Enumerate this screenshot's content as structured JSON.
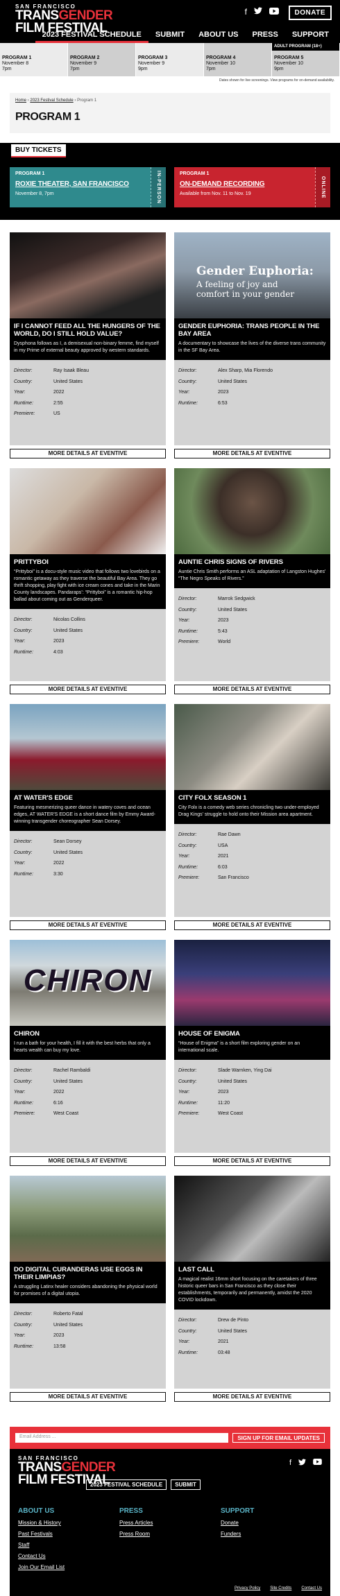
{
  "header": {
    "logo": {
      "small": "SAN FRANCISCO",
      "trans": "TRANS",
      "gender": "GENDER",
      "film": "FILM FESTIVAL"
    },
    "social_icons": [
      "facebook-icon",
      "twitter-icon",
      "youtube-icon"
    ],
    "donate_label": "DONATE",
    "nav": [
      "2023 FESTIVAL SCHEDULE",
      "SUBMIT",
      "ABOUT US",
      "PRESS",
      "SUPPORT"
    ]
  },
  "programs": [
    {
      "name": "PROGRAM 1",
      "date": "November 8",
      "time": "7pm"
    },
    {
      "name": "PROGRAM 2",
      "date": "November 9",
      "time": "7pm"
    },
    {
      "name": "PROGRAM 3",
      "date": "November 9",
      "time": "9pm"
    },
    {
      "name": "PROGRAM 4",
      "date": "November 10",
      "time": "7pm"
    },
    {
      "name": "PROGRAM 5",
      "date": "November 10",
      "time": "9pm",
      "badge": "ADULT PROGRAM (18+)"
    }
  ],
  "strip_note": "Dates shown for live screenings. View programs for on-demand availability.",
  "breadcrumb": {
    "home": "Home",
    "schedule": "2023 Festival Schedule",
    "current": "Program 1"
  },
  "page_title": "PROGRAM 1",
  "tickets": {
    "label": "BUY TICKETS",
    "items": [
      {
        "program": "PROGRAM 1",
        "venue": "ROXIE THEATER, SAN FRANCISCO",
        "date": "November 8, 7pm",
        "mode": "IN-PERSON"
      },
      {
        "program": "PROGRAM 1",
        "venue": "ON-DEMAND RECORDING",
        "date": "Available from Nov. 11 to Nov. 19",
        "mode": "ONLINE"
      }
    ]
  },
  "meta_labels": {
    "director": "Director:",
    "country": "Country:",
    "year": "Year:",
    "runtime": "Runtime:",
    "premiere": "Premiere:"
  },
  "eventive_label": "MORE DETAILS AT EVENTIVE",
  "films": [
    {
      "title": "IF I CANNOT FEED ALL THE HUNGERS OF THE WORLD, DO I STILL HOLD VALUE?",
      "desc": "Dysphona follows as I, a demisexual non-binary femme, find myself in my Prime of external beauty approved by western standards.",
      "director": "Ray Isaak Bleau",
      "country": "United States",
      "year": "2022",
      "runtime": "2:55",
      "premiere": "US"
    },
    {
      "title": "GENDER EUPHORIA: TRANS PEOPLE IN THE BAY AREA",
      "desc": "A documentary to showcase the lives of the diverse trans community in the SF Bay Area.",
      "director": "Alex Sharp, Mia Florendo",
      "country": "United States",
      "year": "2023",
      "runtime": "6:53",
      "premiere": "",
      "thumb_title": "Gender Euphoria:",
      "thumb_sub": "A feeling of joy and comfort in your gender"
    },
    {
      "title": "PRITTYBOI",
      "desc": "“Prittyboi” is a docu-style music video that follows two lovebirds on a romantic getaway as they traverse the beautiful Bay Area. They go thrift shopping, play fight with ice cream cones and take in the Marin County landscapes. Pandaraps’: “Prittyboi” is a romantic hip-hop ballad about coming out as Genderqueer.",
      "director": "Nicolas Collins",
      "country": "United States",
      "year": "2023",
      "runtime": "4:03",
      "premiere": ""
    },
    {
      "title": "AUNTIE CHRIS SIGNS OF RIVERS",
      "desc": "Auntie Chris Smith performs an ASL adaptation of Langston Hughes' “The Negro Speaks of Rivers.”",
      "director": "Marrok Sedgwick",
      "country": "United States",
      "year": "2023",
      "runtime": "5:43",
      "premiere": "World"
    },
    {
      "title": "AT WATER'S EDGE",
      "desc": "Featuring mesmerizing queer dance in watery coves and ocean edges, AT WATER'S EDGE is a short dance film by Emmy Award-winning transgender choreographer Sean Dorsey.",
      "director": "Sean Dorsey",
      "country": "United States",
      "year": "2022",
      "runtime": "3:30",
      "premiere": ""
    },
    {
      "title": "CITY FOLX SEASON 1",
      "desc": "City Folx is a comedy web series chronicling two under-employed Drag Kings' struggle to hold onto their Mission area apartment.",
      "director": "Rae Dawn",
      "country": "USA",
      "year": "2021",
      "runtime": "6:03",
      "premiere": "San Francisco"
    },
    {
      "title": "CHIRON",
      "desc": "I run a bath for your health, I fill it with the best herbs that only a hearts wealth can buy my love.",
      "director": "Rachel Rambaldi",
      "country": "United States",
      "year": "2022",
      "runtime": "6:16",
      "premiere": "West Coast",
      "thumb_title": "CHIRON"
    },
    {
      "title": "HOUSE OF ENIGMA",
      "desc": "“House of Enigma” is a short film exploring gender on an international scale.",
      "director": "Slade Warnken, Ying Dai",
      "country": "United States",
      "year": "2023",
      "runtime": "11:20",
      "premiere": "West Coast"
    },
    {
      "title": "DO DIGITAL CURANDERAS USE EGGS IN THEIR LIMPIAS?",
      "desc": "A struggling Latinx healer considers abandoning the physical world for promises of a digital utopia.",
      "director": "Roberto Fatal",
      "country": "United States",
      "year": "2023",
      "runtime": "13:58",
      "premiere": ""
    },
    {
      "title": "LAST CALL",
      "desc": "A magical realist 16mm short focusing on the caretakers of three historic queer bars in San Francisco as they close their establishments, temporarily and permanently, amidst the 2020 COVID lockdown.",
      "director": "Drew de Pinto",
      "country": "United States",
      "year": "2021",
      "runtime": "03:48",
      "premiere": ""
    }
  ],
  "signup": {
    "placeholder": "Email Address ...",
    "button": "SIGN UP FOR EMAIL UPDATES"
  },
  "footer": {
    "buttons": [
      "2023 FESTIVAL SCHEDULE",
      "SUBMIT"
    ],
    "columns": [
      {
        "heading": "ABOUT US",
        "links": [
          "Mission & History",
          "Past Festivals",
          "Staff",
          "Contact Us",
          "Join Our Email List"
        ]
      },
      {
        "heading": "PRESS",
        "links": [
          "Press Articles",
          "Press Room"
        ]
      },
      {
        "heading": "SUPPORT",
        "links": [
          "Donate",
          "Funders"
        ]
      }
    ],
    "legal": [
      "Privacy Policy",
      "Site Credits",
      "Contact Us"
    ]
  },
  "colors": {
    "accent_red": "#e8313a",
    "teal": "#2f8a8d",
    "ticket_red": "#c8242f",
    "footer_heading": "#5bb5c8"
  }
}
